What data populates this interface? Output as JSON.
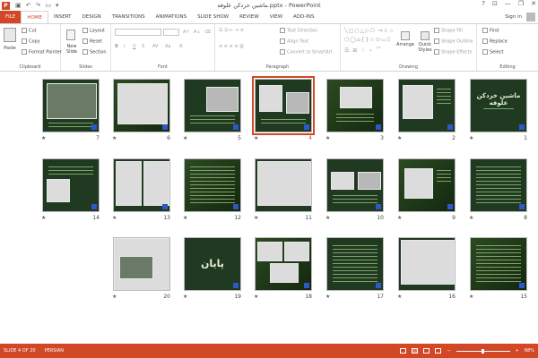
{
  "titlebar": {
    "title": "ماشین خردکن علوفه.pptx - PowerPoint",
    "minimize": "—",
    "restore": "❐",
    "close": "✕",
    "help": "?",
    "ribbon_display": "⊡"
  },
  "tabs": [
    "FILE",
    "HOME",
    "INSERT",
    "DESIGN",
    "TRANSITIONS",
    "ANIMATIONS",
    "SLIDE SHOW",
    "REVIEW",
    "VIEW",
    "ADD-INS"
  ],
  "account": {
    "signin": "Sign in"
  },
  "ribbon": {
    "clipboard": {
      "paste": "Paste",
      "cut": "Cut",
      "copy": "Copy",
      "format_painter": "Format Painter",
      "label": "Clipboard"
    },
    "slides": {
      "new_slide": "New Slide",
      "layout": "Layout",
      "reset": "Reset",
      "section": "Section",
      "label": "Slides"
    },
    "font": {
      "label": "Font",
      "bold": "B",
      "italic": "I",
      "underline": "U",
      "strike": "S",
      "aa": "Aa"
    },
    "paragraph": {
      "text_direction": "Text Direction",
      "align_text": "Align Text",
      "convert_smartart": "Convert to SmartArt",
      "label": "Paragraph"
    },
    "drawing": {
      "arrange": "Arrange",
      "quick_styles": "Quick Styles",
      "shape_fill": "Shape Fill",
      "shape_outline": "Shape Outline",
      "shape_effects": "Shape Effects",
      "label": "Drawing"
    },
    "editing": {
      "find": "Find",
      "replace": "Replace",
      "select": "Select",
      "label": "Editing"
    }
  },
  "slides": [
    {
      "number": "1",
      "title": "ماشین خردکن علوفه"
    },
    {
      "number": "2",
      "title": ""
    },
    {
      "number": "3",
      "title": ""
    },
    {
      "number": "4",
      "title": ""
    },
    {
      "number": "5",
      "title": ""
    },
    {
      "number": "6",
      "title": ""
    },
    {
      "number": "7",
      "title": ""
    },
    {
      "number": "8",
      "title": ""
    },
    {
      "number": "9",
      "title": ""
    },
    {
      "number": "10",
      "title": ""
    },
    {
      "number": "11",
      "title": ""
    },
    {
      "number": "12",
      "title": ""
    },
    {
      "number": "13",
      "title": ""
    },
    {
      "number": "14",
      "title": ""
    },
    {
      "number": "15",
      "title": ""
    },
    {
      "number": "16",
      "title": ""
    },
    {
      "number": "17",
      "title": ""
    },
    {
      "number": "18",
      "title": ""
    },
    {
      "number": "19",
      "title": "پایان"
    },
    {
      "number": "20",
      "title": ""
    }
  ],
  "selected_slide": "4",
  "star": "★",
  "status": {
    "slide_info": "SLIDE 4 OF 20",
    "language": "PERSIAN",
    "zoom": "68%",
    "minus": "−",
    "plus": "+"
  },
  "colors": {
    "accent": "#d24726",
    "slide_bg": "#1f3a20",
    "logo_blue": "#2d58c8"
  }
}
